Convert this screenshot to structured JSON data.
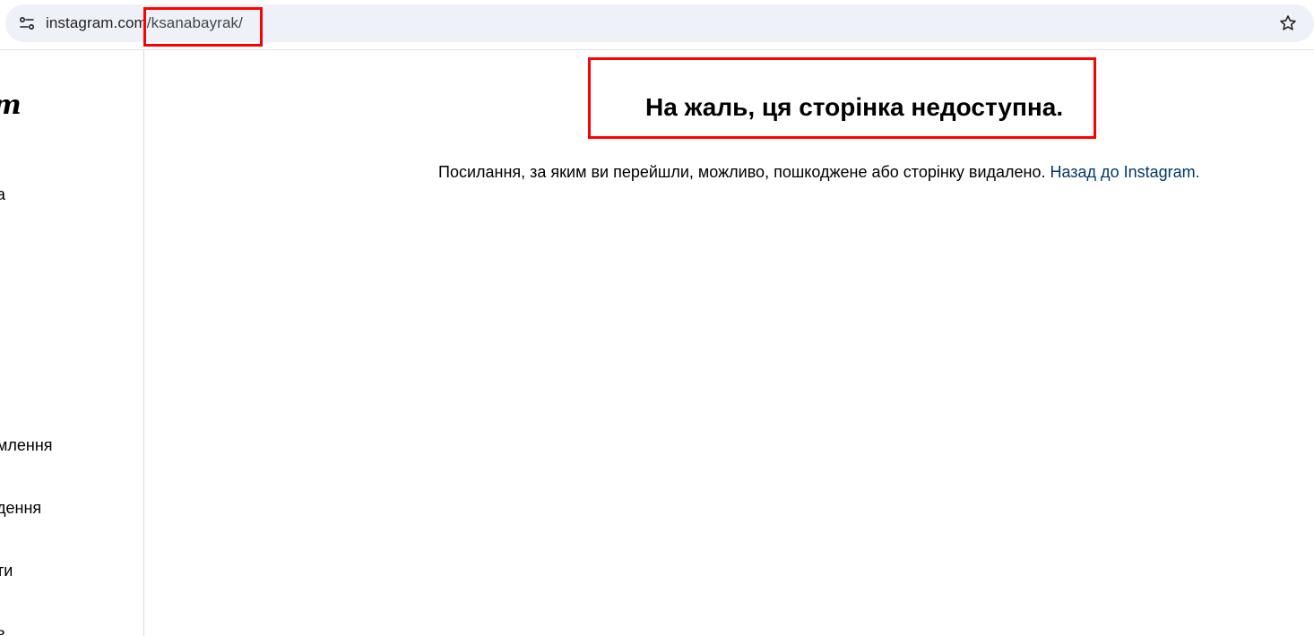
{
  "browser": {
    "url_host": "instagram.com",
    "url_path": "/ksanabayrak/"
  },
  "sidebar": {
    "logo_fragment": "m",
    "items": [
      {
        "label": "а"
      },
      {
        "label": "млення"
      },
      {
        "label": "дення"
      },
      {
        "label": "ти"
      },
      {
        "label": "ь"
      }
    ]
  },
  "error": {
    "title": "На жаль, ця сторінка недоступна.",
    "message": "Посилання, за яким ви перейшли, можливо, пошкоджене або сторінку видалено. ",
    "link_label": "Назад до Instagram."
  },
  "colors": {
    "link": "#00376b",
    "annotation": "#ff0000",
    "omnibox_bg": "#eef1f8"
  },
  "icons": [
    "site-info-icon",
    "bookmark-star-icon"
  ]
}
